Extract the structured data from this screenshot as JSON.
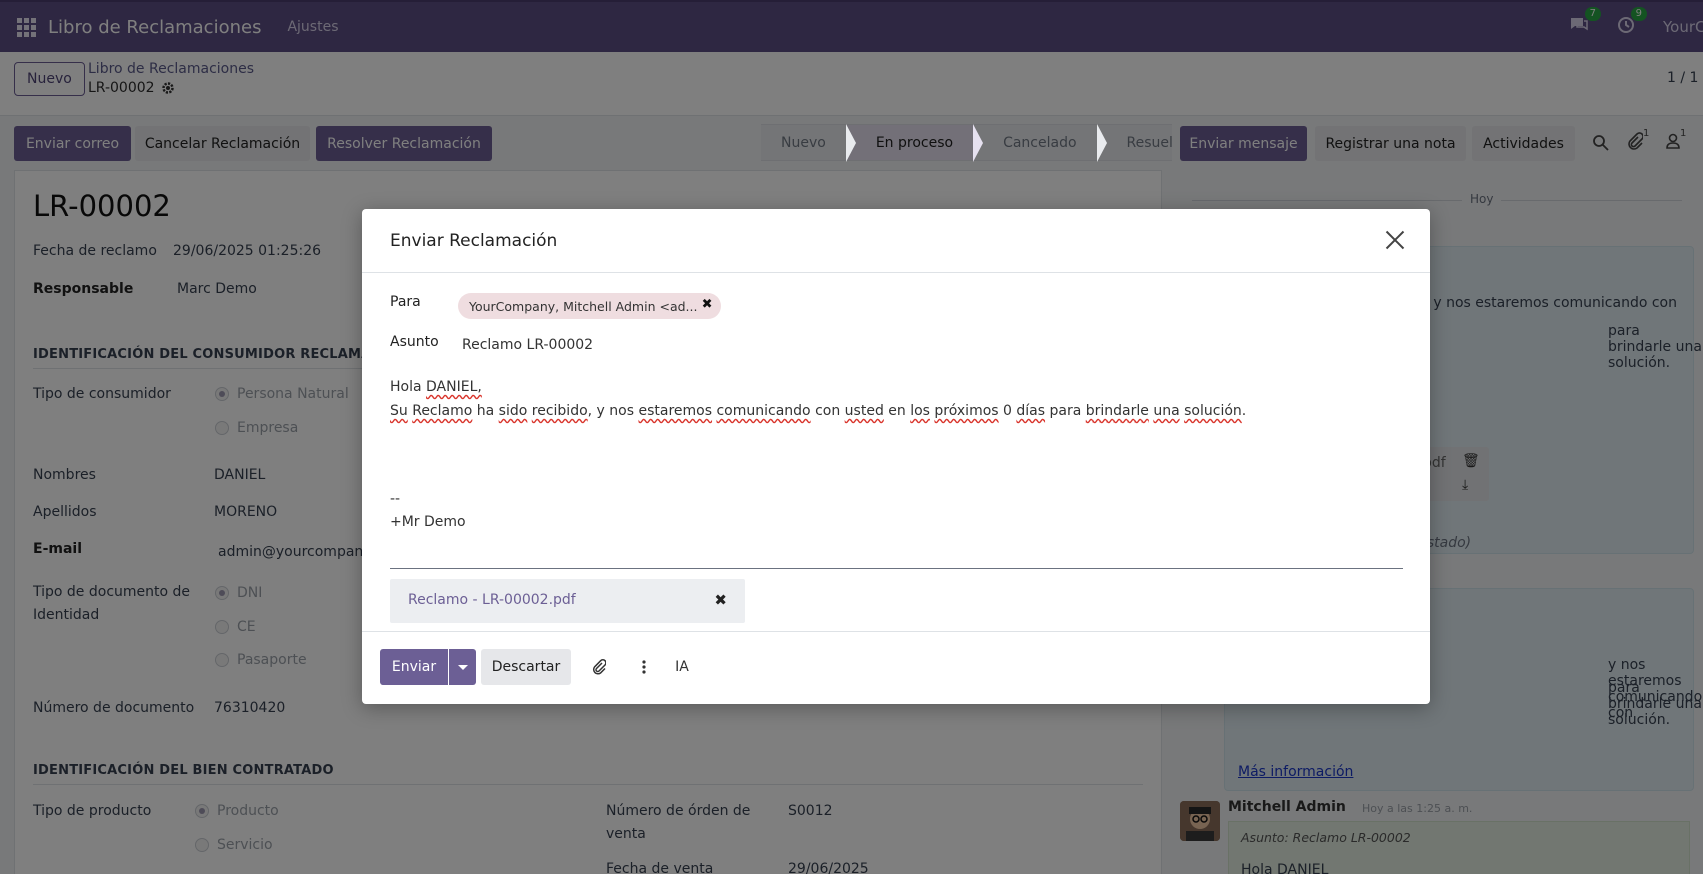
{
  "navbar": {
    "app_title": "Libro de Reclamaciones",
    "menu_settings": "Ajustes",
    "messages_badge": "7",
    "activities_badge": "9",
    "company": "YourCompany"
  },
  "control": {
    "new_label": "Nuevo",
    "breadcrumb_parent": "Libro de Reclamaciones",
    "breadcrumb_current": "LR-00002",
    "pager": "1 / 1"
  },
  "actions": {
    "send_email": "Enviar correo",
    "cancel_claim": "Cancelar Reclamación",
    "resolve_claim": "Resolver Reclamación"
  },
  "statusbar": {
    "steps": [
      "Nuevo",
      "En proceso",
      "Cancelado",
      "Resuelto"
    ],
    "active": "En proceso"
  },
  "chatter_actions": {
    "send_message": "Enviar mensaje",
    "log_note": "Registrar una nota",
    "activities": "Actividades",
    "attachments_count": "1",
    "followers_count": "1"
  },
  "form": {
    "title": "LR-00002",
    "claim_date_label": "Fecha de reclamo",
    "claim_date": "29/06/2025 01:25:26",
    "responsible_label": "Responsable",
    "responsible": "Marc Demo",
    "section_consumer": "IDENTIFICACIÓN DEL CONSUMIDOR RECLAMANTE",
    "consumer_type_label": "Tipo de consumidor",
    "consumer_type_options": [
      "Persona Natural",
      "Empresa"
    ],
    "names_label": "Nombres",
    "names": "DANIEL",
    "surnames_label": "Apellidos",
    "surnames": "MORENO",
    "email_label": "E-mail",
    "email": "admin@yourcompany",
    "doc_type_label_1": "Tipo de documento de",
    "doc_type_label_2": "Identidad",
    "doc_type_options": [
      "DNI",
      "CE",
      "Pasaporte"
    ],
    "doc_number_label": "Número de documento",
    "doc_number": "76310420",
    "section_good": "IDENTIFICACIÓN DEL BIEN CONTRATADO",
    "product_type_label": "Tipo de producto",
    "product_type_options": [
      "Producto",
      "Servicio"
    ],
    "order_number_label_1": "Número de órden de",
    "order_number_label_2": "venta",
    "order_number": "S0012",
    "sale_date_label": "Fecha de venta",
    "sale_date": "29/06/2025"
  },
  "chatter": {
    "date_separator": "Hoy",
    "card1_line1": "y nos estaremos comunicando con",
    "card1_line2": "para brindarle una solución.",
    "attachment_partial": "pdf",
    "status_partial": "Estado)",
    "card2_line1": "y nos estaremos comunicando con",
    "card2_line2": "para brindarle una solución.",
    "more_info": "Más información",
    "author": "Mitchell Admin",
    "author_time": "Hoy a las 1:25 a. m.",
    "subject_line": "Asunto: Reclamo LR-00002",
    "greeting_partial": "Hola DANIEL"
  },
  "modal": {
    "title": "Enviar Reclamación",
    "to_label": "Para",
    "recipient_tag": "YourCompany, Mitchell Admin <ad...",
    "subject_label": "Asunto",
    "subject": "Reclamo LR-00002",
    "body_greeting_pre": "Hola ",
    "body_greeting_name": "DANIEL,",
    "signature_sep": "--",
    "signature": "+Mr Demo",
    "attachment_name": "Reclamo - LR-00002.pdf",
    "send_label": "Enviar",
    "discard_label": "Descartar",
    "ai_label": "IA"
  }
}
